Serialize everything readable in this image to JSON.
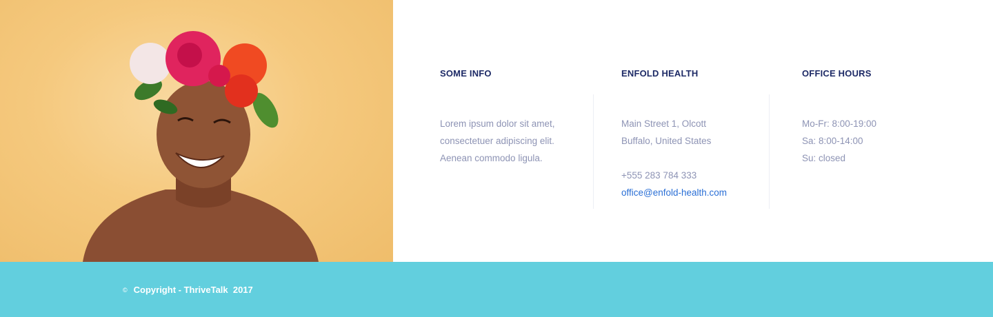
{
  "photo": {
    "alt_icon": "woman-with-flower-crown-photo"
  },
  "columns": [
    {
      "heading": "SOME INFO",
      "lines": [
        "Lorem ipsum dolor sit amet,",
        "consectetuer adipiscing elit.",
        "Aenean commodo ligula."
      ]
    },
    {
      "heading": "ENFOLD HEALTH",
      "address": [
        "Main Street 1, Olcott",
        "Buffalo, United States"
      ],
      "phone": "+555 283 784 333",
      "email": "office@enfold-health.com"
    },
    {
      "heading": "OFFICE HOURS",
      "lines": [
        "Mo-Fr: 8:00-19:00",
        "Sa: 8:00-14:00",
        "Su: closed"
      ]
    }
  ],
  "footer": {
    "copyright_symbol": "©",
    "copyright_text": "Copyright - ThriveTalk  2017"
  },
  "colors": {
    "footer_bg": "#62cfde",
    "heading": "#1d2a66",
    "body_text": "#8d93b4",
    "link": "#2a6fd6",
    "photo_bg": "#f5c97e"
  }
}
